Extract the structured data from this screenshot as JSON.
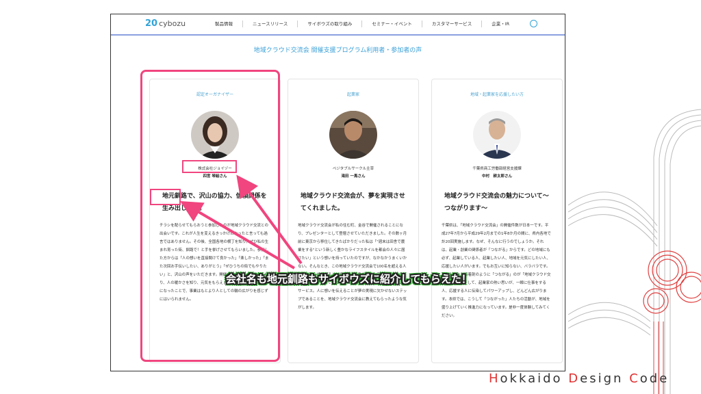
{
  "nav": {
    "logo_num": "20",
    "logo_text": "cybozu",
    "items": [
      "製品情報",
      "ニュースリリース",
      "サイボウズの取り組み",
      "セミナー・イベント",
      "カスタマーサービス",
      "企業・IR"
    ]
  },
  "page_title": "地域クラウド交流会 開催支援プログラム利用者・参加者の声",
  "cards": [
    {
      "category": "認定オーガナイザー",
      "company": "株式会社ジョイゾー",
      "person": "四宮 琴絵さん",
      "headline": "地元釧路で、沢山の協力、信頼関係を生み出したい。",
      "body": "チラシを配らせてもらおうと参加したのが地域クラウド交流との出会いです。これが人生を変えるきっかけになったと言っても過言ではありません。その後、全国各地の横丁を知り、ぜひ私の生まれ育った街、釧路で！と手を挙げさせてもらいました。参加した方からは「人の想いを直接聞けて良かった」「楽しかった」「また次回お手伝いしたい、ありがとう」「ぜひうちの街でもやりたい」と、沢山の声をいただきます。開催するごとに、勉強にもなり、人の暖かさを知り、元気をもらえます。認定オーガナイザーになったことで、事業はもとより人としての輪の広がりを感じずにはいられません。"
    },
    {
      "category": "起業家",
      "company": "ベジタブルサークル主宰",
      "person": "滝田 一馬さん",
      "headline": "地域クラウド交流会が、夢を実現させてくれました。",
      "body": "地域クラウド交流会が私の住む町、金谷で開催されることになり、プレゼンターとして登壇させていただきました。その数ヶ月前に東京から移住してきたばかりだった私は「\"週末は田舎で農業をする\"という新しく豊かなライフスタイルを都会の人々に届けたい」という想いを持っていたのですが、なかなかうまくいかない。そんなとき、この地域クラウド交流会で100名を超える人の前で想いを伝えることができ、想像を超えた応援の声をいただけたのです。そして生まれたのが「ベジタブルサークル」というサービス。人に想いを伝えることが夢の実現に欠かせないステップであることを、地域クラウド交流会に教えてもらったような気がします。"
    },
    {
      "category": "地域・起業家を応援したい方",
      "company": "千葉県商工労働部経営支援課",
      "person": "中村　耕太郎さん",
      "headline": "地域クラウド交流会の魅力について〜つながります〜",
      "body": "千葉県は、「地域クラウド交流会」の開催件数が日本一です。平成27年7月から平成29年2月までの1年8か月の間に、県内各地で計20回実施します。なぜ、そんなに行うのでしょうか。それは、起業・創業の関係者が「つながる」からです。どの地域にも必ず、起業している人、起業したい人、地域を元気にしたい人、応援したい人がいます。でもお互いに知らない、バラバラです。その人たちを接着剤のように「つながる」のが「地域クラウド交流会」です。そして、起業家の熱い思いが、一瞬に仕事をする人、応援する人に伝染してパワーアップし、どんどん広がります。本県では、こうして「つながった」人たちの活動が、地域を盛り上げていく推進力になっています。是非一度体験してみてください。"
    }
  ],
  "callout": "会社名も地元釧路もサイボウズに紹介してもらえた！",
  "brand": {
    "h": "H",
    "rest1": "okkaido ",
    "d": "D",
    "rest2": "esign ",
    "c": "C",
    "rest3": "ode"
  },
  "colors": {
    "accent": "#f0457e",
    "callout_green": "#33b233",
    "nav_blue": "#3aa0d8"
  }
}
